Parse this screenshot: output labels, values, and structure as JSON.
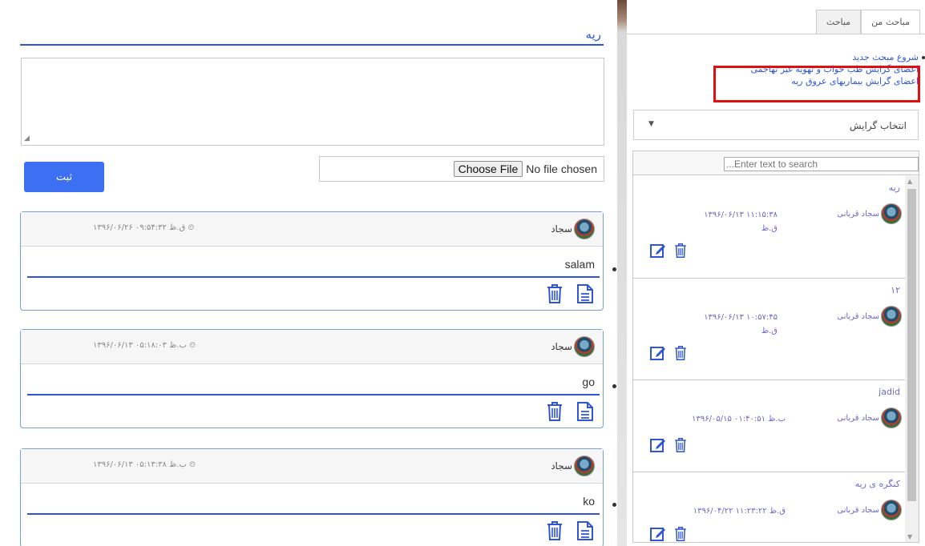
{
  "main": {
    "topic_title": "ریه",
    "submit_label": "ثبت",
    "file_status": "No file chosen",
    "file_button": "Choose File",
    "comments": [
      {
        "user": "سجاد",
        "date": "۱۳۹۶/۰۶/۲۶ ۰۹:۵۴:۳۲ ق.ظ",
        "text": "salam"
      },
      {
        "user": "سجاد",
        "date": "۱۳۹۶/۰۶/۱۳ ۰۵:۱۸:۰۳ ب.ظ",
        "text": "go"
      },
      {
        "user": "سجاد",
        "date": "۱۳۹۶/۰۶/۱۳ ۰۵:۱۳:۳۸ ب.ظ",
        "text": "ko"
      }
    ]
  },
  "sidebar": {
    "tabs": [
      {
        "label": "مباحث"
      },
      {
        "label": "مباحث من"
      }
    ],
    "new_topic": "شروع مبحث جدید",
    "group_links": [
      "اعضای گرایش طب خواب و تهویه غیر تهاجمی",
      "اعضای گرایش بیماریهای عروق ریه"
    ],
    "select_value": "انتخاب گرایش",
    "search_placeholder": "...Enter text to search",
    "items": [
      {
        "title": "ریه",
        "user": "سجاد قربانی",
        "date_line1": "۱۳۹۶/۰۶/۱۳ ۱۱:۱۵:۳۸",
        "date_line2": "ق.ظ"
      },
      {
        "title": "۱۲",
        "user": "سجاد قربانی",
        "date_line1": "۱۳۹۶/۰۶/۱۳ ۱۰:۵۷:۴۵",
        "date_line2": "ق.ظ"
      },
      {
        "title": "jadid",
        "user": "سجاد قربانی",
        "date_line1": "۱۳۹۶/۰۵/۱۵ ۰۱:۴۰:۵۱ ب.ظ",
        "date_line2": ""
      },
      {
        "title": "کنگره ی ریه",
        "user": "سجاد قربانی",
        "date_line1": "۱۳۹۶/۰۴/۲۲ ۱۱:۲۳:۲۲ ق.ظ",
        "date_line2": ""
      }
    ]
  },
  "colors": {
    "accent": "#2f55d4",
    "submit_bg": "#3d6ff2",
    "highlight_border": "#e01010",
    "list_text": "#6a67c8"
  }
}
